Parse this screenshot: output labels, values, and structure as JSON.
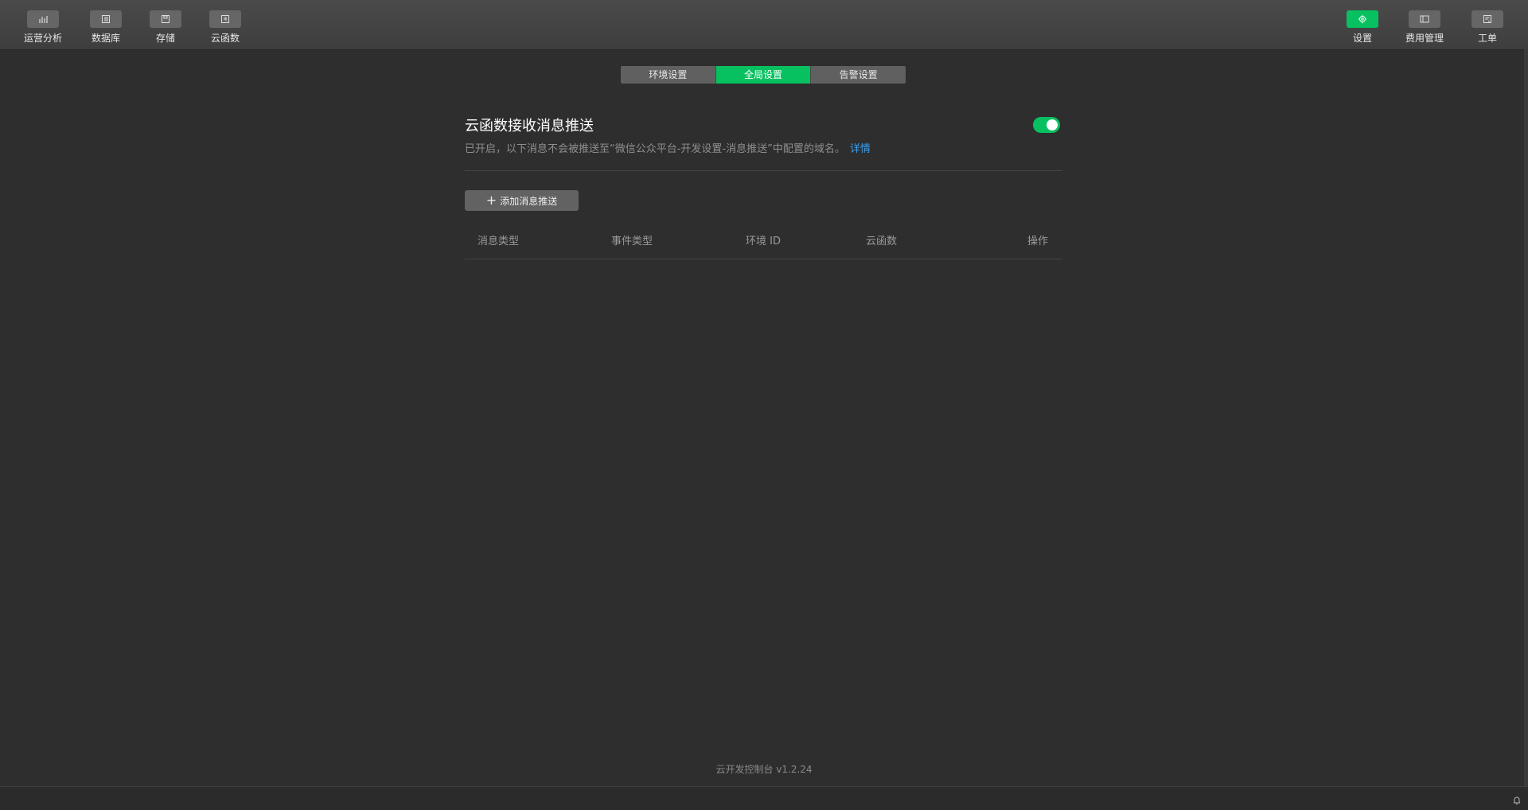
{
  "toolbar": {
    "left": [
      {
        "label": "运营分析",
        "icon": "bar-chart-icon"
      },
      {
        "label": "数据库",
        "icon": "database-icon"
      },
      {
        "label": "存储",
        "icon": "storage-icon"
      },
      {
        "label": "云函数",
        "icon": "cloud-function-icon"
      }
    ],
    "right": [
      {
        "label": "设置",
        "icon": "gear-icon",
        "active": true
      },
      {
        "label": "费用管理",
        "icon": "billing-icon"
      },
      {
        "label": "工单",
        "icon": "ticket-icon"
      }
    ]
  },
  "tabs": [
    {
      "label": "环境设置",
      "active": false
    },
    {
      "label": "全局设置",
      "active": true
    },
    {
      "label": "告警设置",
      "active": false
    }
  ],
  "section": {
    "title": "云函数接收消息推送",
    "description": "已开启，以下消息不会被推送至“微信公众平台-开发设置-消息推送”中配置的域名。",
    "link": "详情",
    "toggle_on": true
  },
  "add_button": {
    "label": "添加消息推送"
  },
  "table": {
    "headers": [
      "消息类型",
      "事件类型",
      "环境 ID",
      "云函数",
      "操作"
    ]
  },
  "footer": {
    "version": "云开发控制台 v1.2.24"
  },
  "colors": {
    "accent": "#07c160",
    "background": "#2e2e2e",
    "link": "#3a9ff0"
  }
}
